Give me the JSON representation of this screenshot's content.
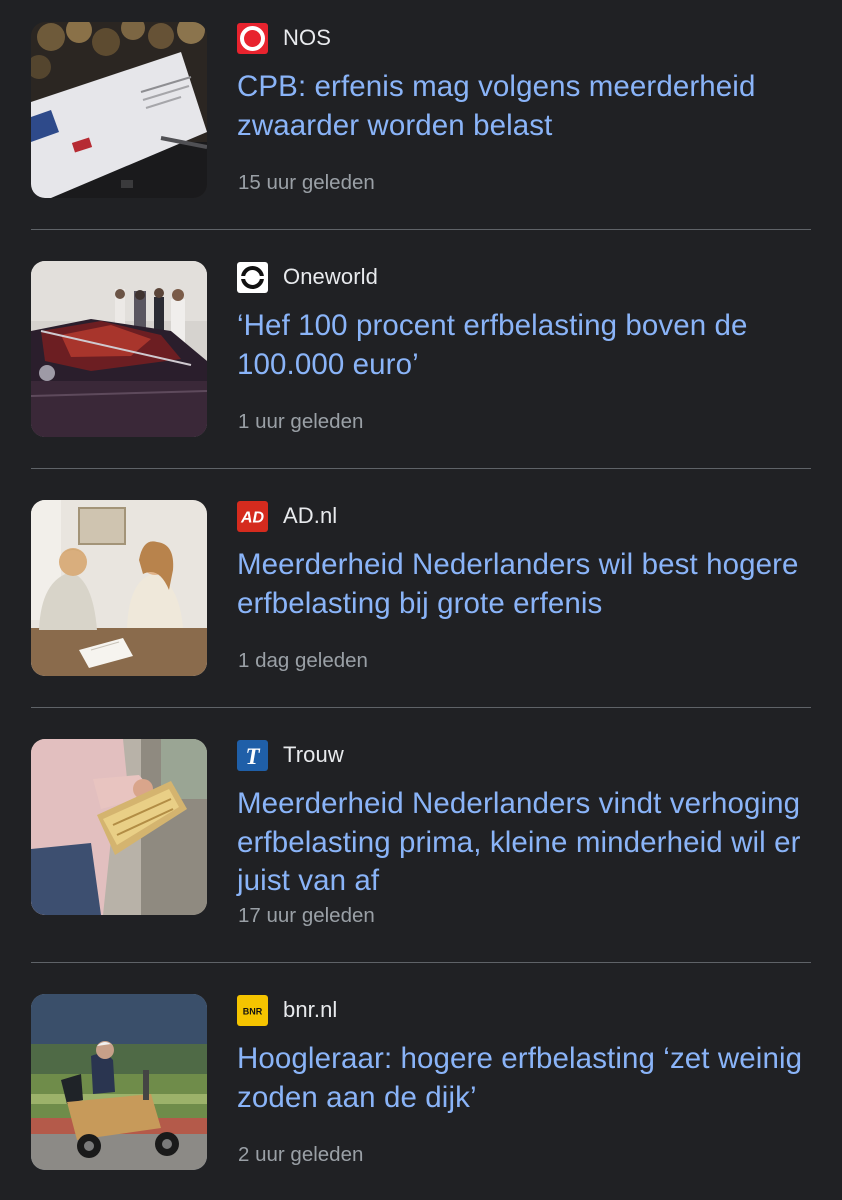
{
  "articles": [
    {
      "source": "NOS",
      "source_logo": "nos-logo",
      "headline": "CPB: erfenis mag volgens meerderheid zwaarder worden belast",
      "time": "15 uur geleden",
      "thumbnail": "envelope-and-coins-photo"
    },
    {
      "source": "Oneworld",
      "source_logo": "oneworld-logo",
      "headline": "‘Hef 100 procent erfbelasting boven de 100.000 euro’",
      "time": "1 uur geleden",
      "thumbnail": "people-beside-red-car-photo"
    },
    {
      "source": "AD.nl",
      "source_logo": "ad-logo",
      "headline": "Meerderheid Nederlanders wil best hogere erfbelasting bij grote erfenis",
      "time": "1 dag geleden",
      "thumbnail": "two-women-at-table-photo"
    },
    {
      "source": "Trouw",
      "source_logo": "trouw-logo",
      "headline": "Meerderheid Nederlanders vindt verhoging erfbelasting prima, kleine minderheid wil er juist van af",
      "time": "17 uur geleden",
      "thumbnail": "hand-with-banknotes-photo"
    },
    {
      "source": "bnr.nl",
      "source_logo": "bnr-logo",
      "headline": "Hoogleraar: hogere erfbelasting ‘zet weinig zoden aan de dijk’",
      "time": "2 uur geleden",
      "thumbnail": "man-on-mobility-scooter-photo"
    }
  ],
  "colors": {
    "background": "#202124",
    "headline": "#8ab4f8",
    "source_text": "#e8eaed",
    "time_text": "#9aa0a6",
    "divider": "#5f6368"
  }
}
